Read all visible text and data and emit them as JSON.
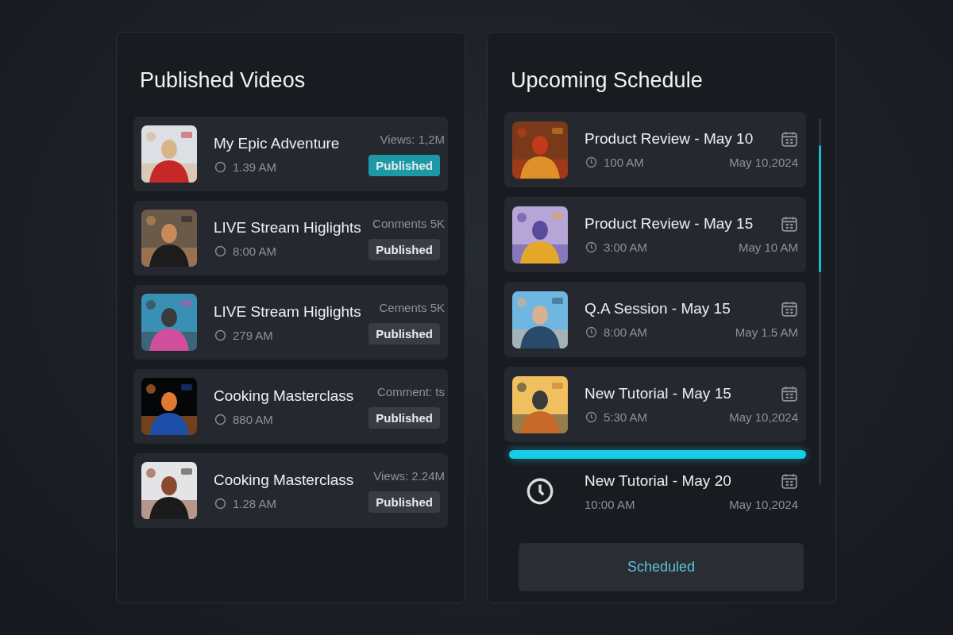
{
  "published": {
    "title": "Published Videos",
    "videos": [
      {
        "title": "My Epic Adventure",
        "time": "1.39 AM",
        "stat": "Views: 1,2M",
        "status": "Published",
        "highlighted": true
      },
      {
        "title": "LIVE Stream Higlights",
        "time": "8:00 AM",
        "stat": "Conments 5K",
        "status": "Published",
        "highlighted": false
      },
      {
        "title": "LIVE Stream Higlights",
        "time": "279 AM",
        "stat": "Cements 5K",
        "status": "Published",
        "highlighted": false
      },
      {
        "title": "Cooking Masterclass",
        "time": "880 AM",
        "stat": "Comment: ts",
        "status": "Published",
        "highlighted": false
      },
      {
        "title": "Cooking Masterclass",
        "time": "1.28 AM",
        "stat": "Views: 2.24M",
        "status": "Published",
        "highlighted": false
      }
    ]
  },
  "schedule": {
    "title": "Upcoming Schedule",
    "items": [
      {
        "kind": "thumbnail",
        "title": "Product Review - May 10",
        "time": "100 AM",
        "date": "May 10,2024"
      },
      {
        "kind": "thumbnail",
        "title": "Product Review - May 15",
        "time": "3:00 AM",
        "date": "May 10 AM"
      },
      {
        "kind": "thumbnail",
        "title": "Q.A Session - May 15",
        "time": "8:00 AM",
        "date": "May 1.5 AM"
      },
      {
        "kind": "thumbnail",
        "title": "New Tutorial - May 15",
        "time": "5:30 AM",
        "date": "May 10,2024"
      },
      {
        "kind": "clock",
        "title": "New Tutorial - May 20",
        "time": "10:00 AM",
        "date": "May 10,2024"
      }
    ],
    "button": "Scheduled"
  }
}
